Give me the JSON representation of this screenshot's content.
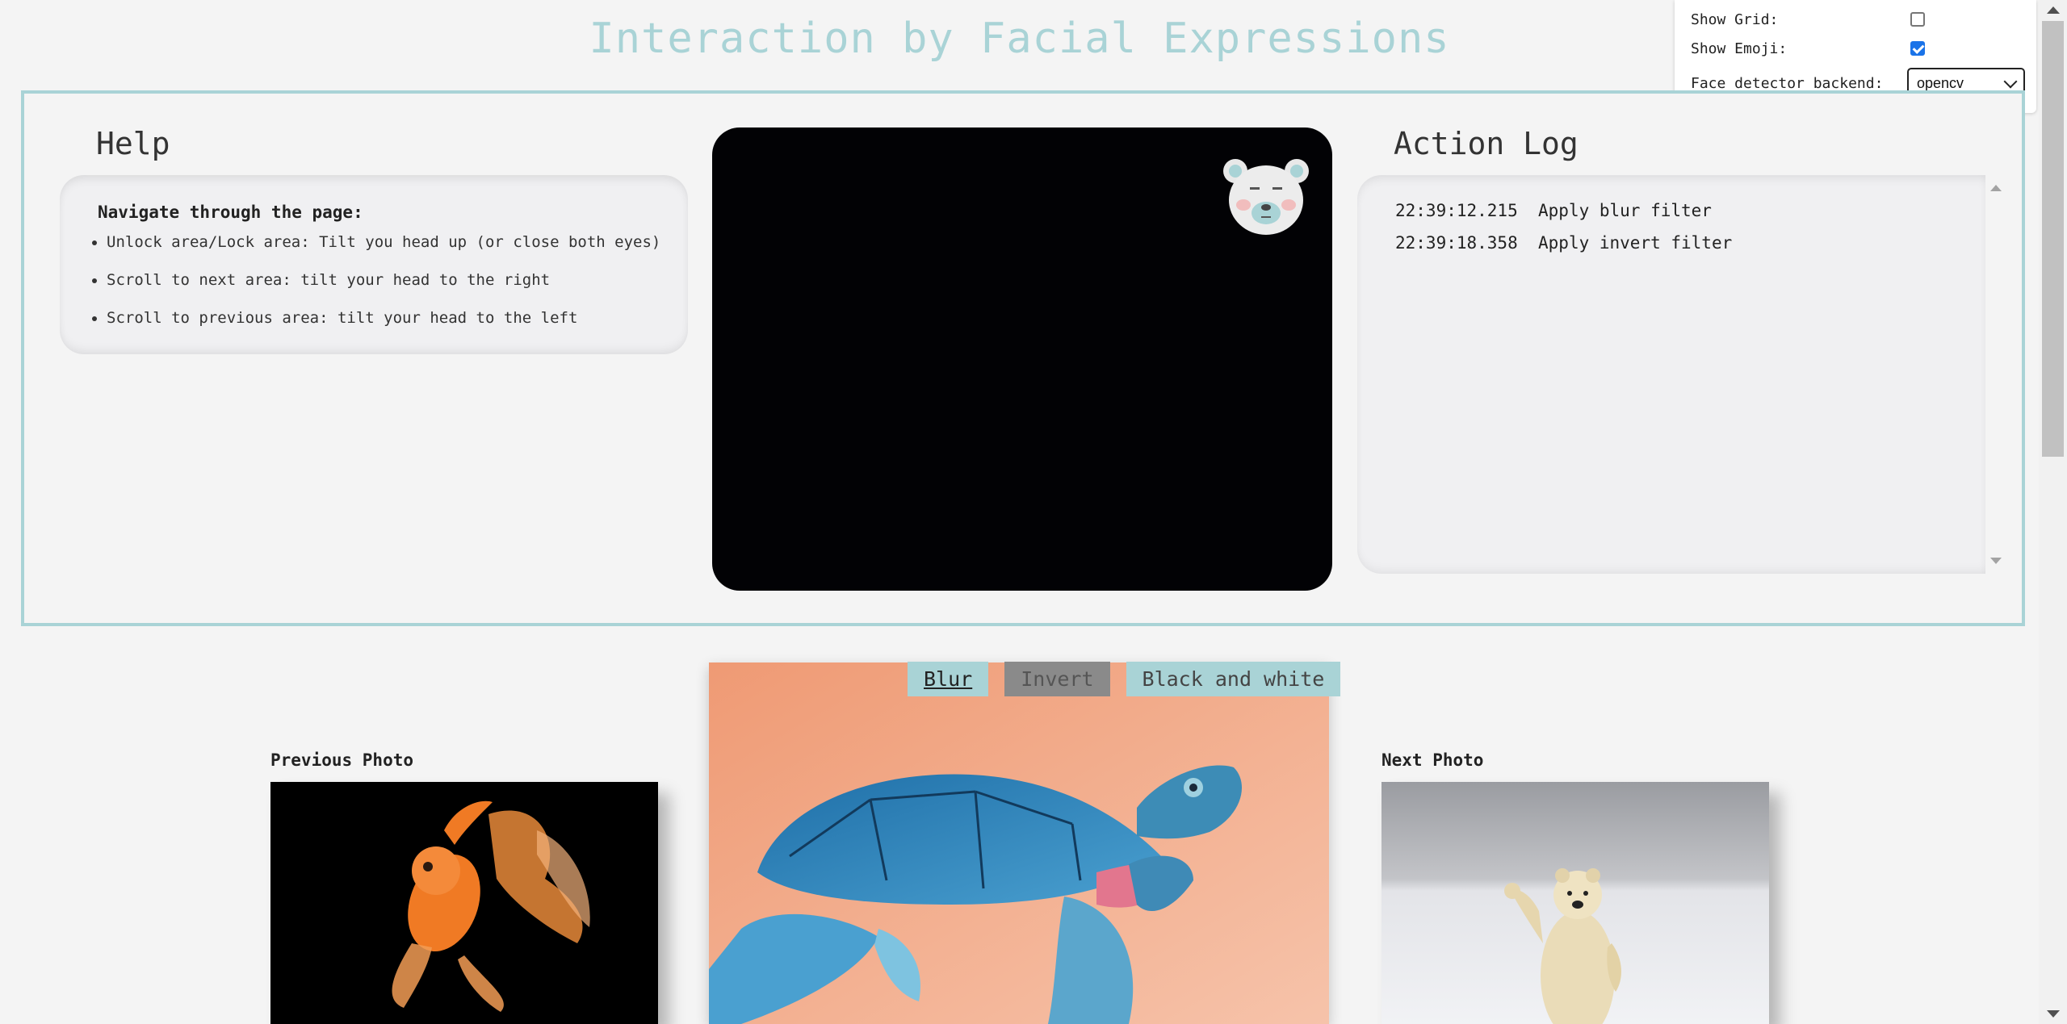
{
  "page_title": "Interaction by Facial Expressions",
  "controls": {
    "show_grid_label": "Show Grid:",
    "show_grid_checked": false,
    "show_emoji_label": "Show Emoji:",
    "show_emoji_checked": true,
    "backend_label": "Face detector backend:",
    "backend_value": "opencv"
  },
  "help": {
    "heading": "Help",
    "nav_title": "Navigate through the page:",
    "items": [
      "Unlock area/Lock area: Tilt you head up (or close both eyes)",
      "Scroll to next area: tilt your head to the right",
      "Scroll to previous area: tilt your head to the left"
    ]
  },
  "video": {
    "emoji_icon": "polar-bear-emoji"
  },
  "action_log": {
    "heading": "Action Log",
    "entries": [
      {
        "time": "22:39:12.215",
        "action": "Apply blur filter"
      },
      {
        "time": "22:39:18.358",
        "action": "Apply invert filter"
      }
    ]
  },
  "gallery": {
    "previous_label": "Previous Photo",
    "next_label": "Next Photo",
    "filters": [
      {
        "label": "Blur",
        "state": "active"
      },
      {
        "label": "Invert",
        "state": "disabled"
      },
      {
        "label": "Black and white",
        "state": "normal"
      }
    ]
  },
  "colors": {
    "accent": "#a9d3d6",
    "checkbox_on": "#1a73e8"
  }
}
